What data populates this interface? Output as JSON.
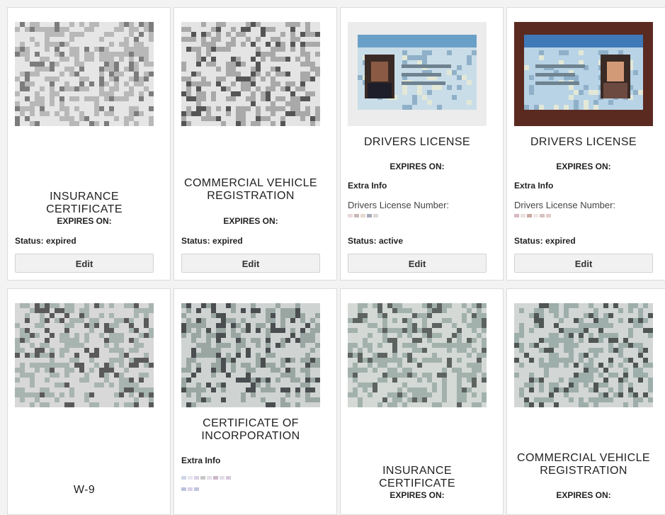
{
  "documents": [
    {
      "title_lines": [
        "INSURANCE CERTIFICATE"
      ],
      "expires_label": "EXPIRES ON:",
      "status": "Status: expired",
      "edit_label": "Edit",
      "thumb_style": "paper-scan",
      "thumb_colors": [
        "#e6e6e6",
        "#b8b8b8",
        "#7c7c7c"
      ]
    },
    {
      "title_lines": [
        "COMMERCIAL VEHICLE",
        "REGISTRATION"
      ],
      "expires_label": "EXPIRES ON:",
      "status": "Status: expired",
      "edit_label": "Edit",
      "thumb_style": "paper-scan",
      "thumb_colors": [
        "#e4e4e4",
        "#a9a9a9",
        "#555555"
      ]
    },
    {
      "title_lines": [
        "DRIVERS LICENSE"
      ],
      "expires_label": "EXPIRES ON:",
      "extra_label": "Extra Info",
      "license_label": "Drivers License Number:",
      "status": "Status: active",
      "edit_label": "Edit",
      "thumb_style": "license-card",
      "thumb_colors": [
        "#ececec",
        "#a9c7dc",
        "#6b4a3a"
      ]
    },
    {
      "title_lines": [
        "DRIVERS LICENSE"
      ],
      "expires_label": "EXPIRES ON:",
      "extra_label": "Extra Info",
      "license_label": "Drivers License Number:",
      "status": "Status: expired",
      "edit_label": "Edit",
      "thumb_style": "license-card-dark",
      "thumb_colors": [
        "#5a2a20",
        "#b5d0e4",
        "#c58a6a"
      ]
    },
    {
      "title_lines": [
        "W-9"
      ],
      "thumb_style": "paper-scan",
      "thumb_colors": [
        "#d8d8d8",
        "#a8b4b0",
        "#5a5a5a"
      ]
    },
    {
      "title_lines": [
        "CERTIFICATE OF",
        "INCORPORATION"
      ],
      "extra_label": "Extra Info",
      "thumb_style": "paper-scan",
      "thumb_colors": [
        "#cfd4d2",
        "#9aa6a2",
        "#4a4e50"
      ]
    },
    {
      "title_lines": [
        "INSURANCE CERTIFICATE"
      ],
      "expires_label": "EXPIRES ON:",
      "thumb_style": "paper-scan",
      "thumb_colors": [
        "#d4d9d6",
        "#a2b1ac",
        "#5d6360"
      ]
    },
    {
      "title_lines": [
        "COMMERCIAL VEHICLE",
        "REGISTRATION"
      ],
      "expires_label": "EXPIRES ON:",
      "thumb_style": "paper-scan",
      "thumb_colors": [
        "#d2d6d4",
        "#9eaeaa",
        "#4f5654"
      ]
    }
  ],
  "redaction_colors": {
    "license_3": [
      "#e9dada",
      "#c9b8b8",
      "#e4d8cf",
      "#a9a9b8",
      "#dfd6d6"
    ],
    "license_4": [
      "#d9b9c0",
      "#e8e0e0",
      "#c9a89f",
      "#f1e5e5",
      "#d8c2c2",
      "#e6ccc8"
    ],
    "incorp_row1": [
      "#cfd3e6",
      "#e8e6f0",
      "#d7cfe4",
      "#c8c8c8",
      "#e5dde9",
      "#cbb7c9",
      "#e2dde8",
      "#d6c8d9"
    ],
    "incorp_row2": [
      "#b9c3de",
      "#d9d1e6",
      "#c1c7dd"
    ]
  }
}
